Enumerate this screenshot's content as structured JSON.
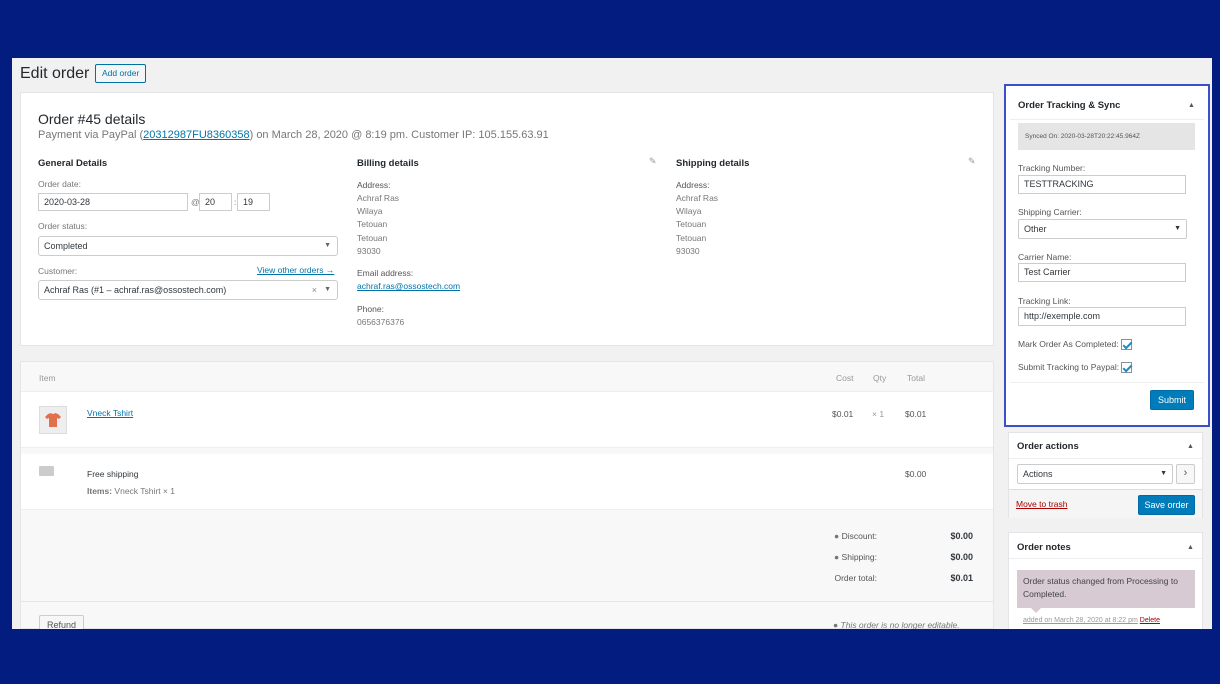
{
  "header": {
    "title": "Edit order",
    "add_button": "Add order"
  },
  "order": {
    "title": "Order #45 details",
    "subtitle_pre": "Payment via PayPal (",
    "transaction_id": "20312987FU8360358",
    "subtitle_post": ") on March 28, 2020 @ 8:19 pm. Customer IP: 105.155.63.91"
  },
  "general": {
    "heading": "General Details",
    "date_label": "Order date:",
    "date_value": "2020-03-28",
    "at_symbol": "@",
    "hour": "20",
    "colon": ":",
    "minute": "19",
    "status_label": "Order status:",
    "status_value": "Completed",
    "customer_label": "Customer:",
    "view_other": "View other orders →",
    "customer_value": "Achraf Ras (#1 – achraf.ras@ossostech.com)"
  },
  "billing": {
    "heading": "Billing details",
    "address_label": "Address:",
    "address_lines": [
      "Achraf Ras",
      "Wilaya",
      "Tetouan",
      "Tetouan",
      "93030"
    ],
    "email_label": "Email address:",
    "email": "achraf.ras@ossostech.com",
    "phone_label": "Phone:",
    "phone": "0656376376"
  },
  "shipping": {
    "heading": "Shipping details",
    "address_label": "Address:",
    "address_lines": [
      "Achraf Ras",
      "Wilaya",
      "Tetouan",
      "Tetouan",
      "93030"
    ]
  },
  "items": {
    "headers": {
      "item": "Item",
      "cost": "Cost",
      "qty": "Qty",
      "total": "Total"
    },
    "product": {
      "name": "Vneck Tshirt",
      "cost": "$0.01",
      "qty": "× 1",
      "total": "$0.01"
    },
    "shipping_line": {
      "name": "Free shipping",
      "items_label": "Items:",
      "items_value": "Vneck Tshirt × 1",
      "total": "$0.00"
    },
    "totals": [
      {
        "label": "Discount:",
        "value": "$0.00"
      },
      {
        "label": "Shipping:",
        "value": "$0.00"
      },
      {
        "label": "Order total:",
        "value": "$0.01"
      }
    ],
    "refund_button": "Refund",
    "not_editable": "This order is no longer editable."
  },
  "tracking": {
    "title": "Order Tracking & Sync",
    "synced": "Synced On: 2020-03-28T20:22:45.964Z",
    "number_label": "Tracking Number:",
    "number_value": "TESTTRACKING",
    "carrier_label": "Shipping Carrier:",
    "carrier_value": "Other",
    "carrier_name_label": "Carrier Name:",
    "carrier_name_value": "Test Carrier",
    "link_label": "Tracking Link:",
    "link_value": "http://exemple.com",
    "mark_completed_label": "Mark Order As Completed:",
    "mark_completed_checked": true,
    "submit_paypal_label": "Submit Tracking to Paypal:",
    "submit_paypal_checked": true,
    "submit_button": "Submit"
  },
  "actions": {
    "title": "Order actions",
    "select_value": "Actions",
    "go_symbol": "›",
    "trash": "Move to trash",
    "save": "Save order"
  },
  "notes": {
    "title": "Order notes",
    "note_text": "Order status changed from Processing to Completed.",
    "meta": "added on March 28, 2020 at 8:22 pm",
    "delete": "Delete"
  },
  "colors": {
    "background": "#031c80",
    "primary": "#007cba",
    "highlight_border": "#3b4fc8",
    "note_bg": "#d7cad2"
  }
}
